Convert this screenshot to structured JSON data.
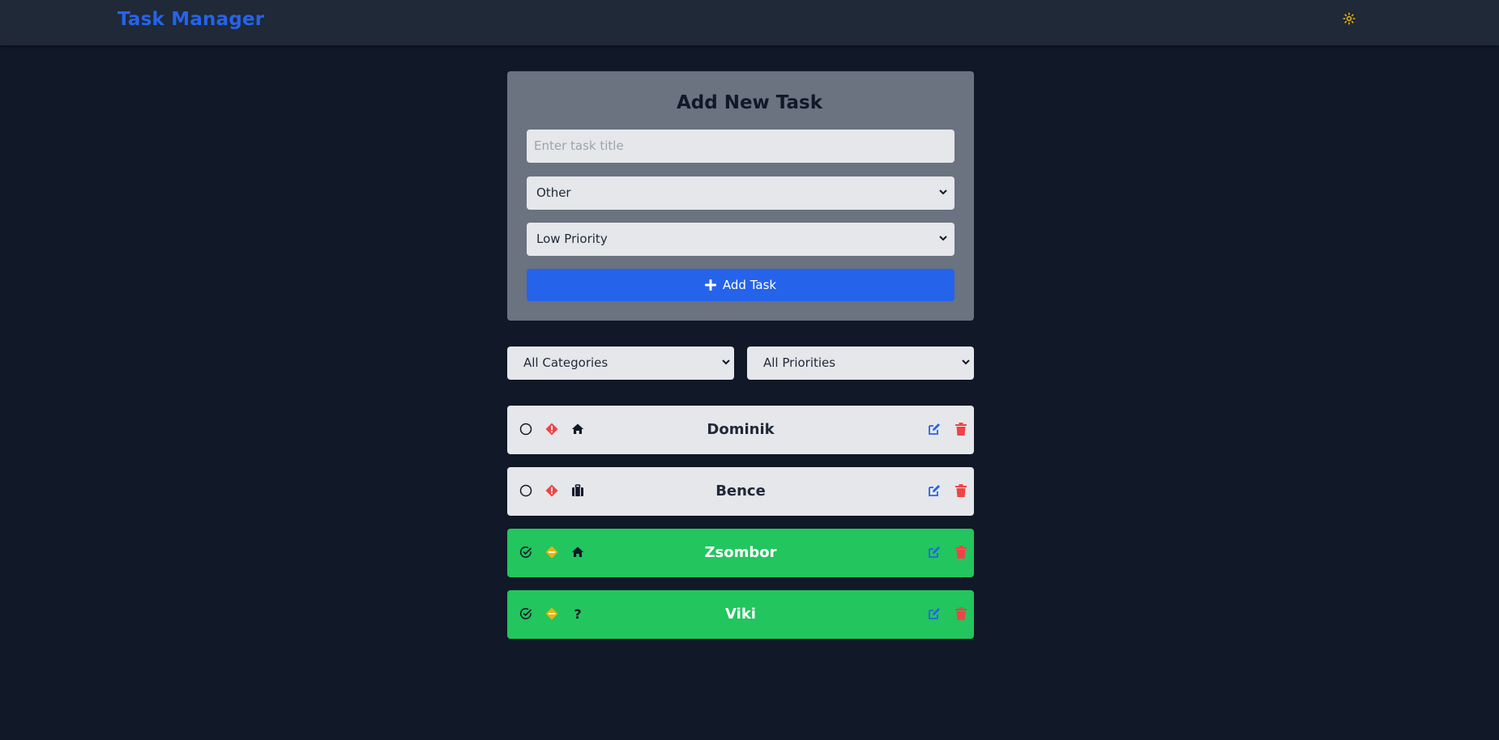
{
  "app": {
    "title": "Task Manager",
    "brand_color": "#2563eb",
    "theme_icon": "sun-icon",
    "background": "#111827"
  },
  "form": {
    "heading": "Add New Task",
    "title_placeholder": "Enter task title",
    "title_value": "",
    "category_selected": "Other",
    "priority_selected": "Low Priority",
    "submit_label": "Add Task",
    "submit_icon": "plus-icon"
  },
  "filters": {
    "category_selected": "All Categories",
    "priority_selected": "All Priorities"
  },
  "tasks": [
    {
      "title": "Dominik",
      "completed": false,
      "priority_icon": "high-priority-icon",
      "category_icon": "home-icon"
    },
    {
      "title": "Bence",
      "completed": false,
      "priority_icon": "high-priority-icon",
      "category_icon": "briefcase-icon"
    },
    {
      "title": "Zsombor",
      "completed": true,
      "priority_icon": "medium-priority-icon",
      "category_icon": "home-icon"
    },
    {
      "title": "Viki",
      "completed": true,
      "priority_icon": "medium-priority-icon",
      "category_icon": "question-icon",
      "category_glyph": "?"
    }
  ],
  "colors": {
    "pending_card": "#e5e7eb",
    "completed_card": "#22c55e",
    "high_priority": "#ef4444",
    "medium_priority": "#eab308",
    "edit": "#2563eb",
    "delete": "#ef4444"
  }
}
